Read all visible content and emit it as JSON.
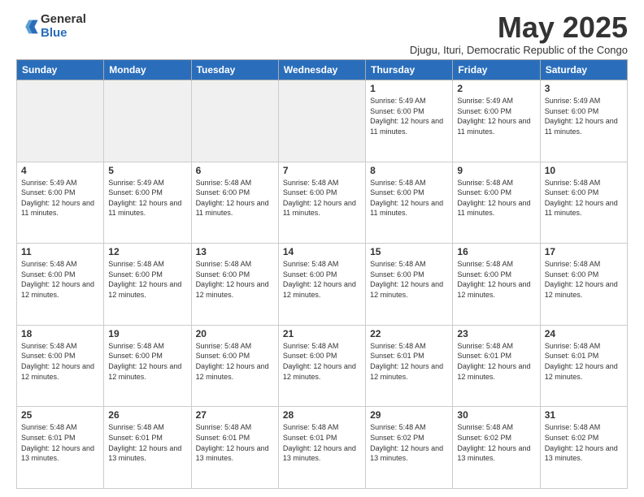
{
  "logo": {
    "general": "General",
    "blue": "Blue"
  },
  "title": "May 2025",
  "subtitle": "Djugu, Ituri, Democratic Republic of the Congo",
  "days_of_week": [
    "Sunday",
    "Monday",
    "Tuesday",
    "Wednesday",
    "Thursday",
    "Friday",
    "Saturday"
  ],
  "weeks": [
    [
      {
        "day": "",
        "info": ""
      },
      {
        "day": "",
        "info": ""
      },
      {
        "day": "",
        "info": ""
      },
      {
        "day": "",
        "info": ""
      },
      {
        "day": "1",
        "info": "Sunrise: 5:49 AM\nSunset: 6:00 PM\nDaylight: 12 hours and 11 minutes."
      },
      {
        "day": "2",
        "info": "Sunrise: 5:49 AM\nSunset: 6:00 PM\nDaylight: 12 hours and 11 minutes."
      },
      {
        "day": "3",
        "info": "Sunrise: 5:49 AM\nSunset: 6:00 PM\nDaylight: 12 hours and 11 minutes."
      }
    ],
    [
      {
        "day": "4",
        "info": "Sunrise: 5:49 AM\nSunset: 6:00 PM\nDaylight: 12 hours and 11 minutes."
      },
      {
        "day": "5",
        "info": "Sunrise: 5:49 AM\nSunset: 6:00 PM\nDaylight: 12 hours and 11 minutes."
      },
      {
        "day": "6",
        "info": "Sunrise: 5:48 AM\nSunset: 6:00 PM\nDaylight: 12 hours and 11 minutes."
      },
      {
        "day": "7",
        "info": "Sunrise: 5:48 AM\nSunset: 6:00 PM\nDaylight: 12 hours and 11 minutes."
      },
      {
        "day": "8",
        "info": "Sunrise: 5:48 AM\nSunset: 6:00 PM\nDaylight: 12 hours and 11 minutes."
      },
      {
        "day": "9",
        "info": "Sunrise: 5:48 AM\nSunset: 6:00 PM\nDaylight: 12 hours and 11 minutes."
      },
      {
        "day": "10",
        "info": "Sunrise: 5:48 AM\nSunset: 6:00 PM\nDaylight: 12 hours and 11 minutes."
      }
    ],
    [
      {
        "day": "11",
        "info": "Sunrise: 5:48 AM\nSunset: 6:00 PM\nDaylight: 12 hours and 12 minutes."
      },
      {
        "day": "12",
        "info": "Sunrise: 5:48 AM\nSunset: 6:00 PM\nDaylight: 12 hours and 12 minutes."
      },
      {
        "day": "13",
        "info": "Sunrise: 5:48 AM\nSunset: 6:00 PM\nDaylight: 12 hours and 12 minutes."
      },
      {
        "day": "14",
        "info": "Sunrise: 5:48 AM\nSunset: 6:00 PM\nDaylight: 12 hours and 12 minutes."
      },
      {
        "day": "15",
        "info": "Sunrise: 5:48 AM\nSunset: 6:00 PM\nDaylight: 12 hours and 12 minutes."
      },
      {
        "day": "16",
        "info": "Sunrise: 5:48 AM\nSunset: 6:00 PM\nDaylight: 12 hours and 12 minutes."
      },
      {
        "day": "17",
        "info": "Sunrise: 5:48 AM\nSunset: 6:00 PM\nDaylight: 12 hours and 12 minutes."
      }
    ],
    [
      {
        "day": "18",
        "info": "Sunrise: 5:48 AM\nSunset: 6:00 PM\nDaylight: 12 hours and 12 minutes."
      },
      {
        "day": "19",
        "info": "Sunrise: 5:48 AM\nSunset: 6:00 PM\nDaylight: 12 hours and 12 minutes."
      },
      {
        "day": "20",
        "info": "Sunrise: 5:48 AM\nSunset: 6:00 PM\nDaylight: 12 hours and 12 minutes."
      },
      {
        "day": "21",
        "info": "Sunrise: 5:48 AM\nSunset: 6:00 PM\nDaylight: 12 hours and 12 minutes."
      },
      {
        "day": "22",
        "info": "Sunrise: 5:48 AM\nSunset: 6:01 PM\nDaylight: 12 hours and 12 minutes."
      },
      {
        "day": "23",
        "info": "Sunrise: 5:48 AM\nSunset: 6:01 PM\nDaylight: 12 hours and 12 minutes."
      },
      {
        "day": "24",
        "info": "Sunrise: 5:48 AM\nSunset: 6:01 PM\nDaylight: 12 hours and 12 minutes."
      }
    ],
    [
      {
        "day": "25",
        "info": "Sunrise: 5:48 AM\nSunset: 6:01 PM\nDaylight: 12 hours and 13 minutes."
      },
      {
        "day": "26",
        "info": "Sunrise: 5:48 AM\nSunset: 6:01 PM\nDaylight: 12 hours and 13 minutes."
      },
      {
        "day": "27",
        "info": "Sunrise: 5:48 AM\nSunset: 6:01 PM\nDaylight: 12 hours and 13 minutes."
      },
      {
        "day": "28",
        "info": "Sunrise: 5:48 AM\nSunset: 6:01 PM\nDaylight: 12 hours and 13 minutes."
      },
      {
        "day": "29",
        "info": "Sunrise: 5:48 AM\nSunset: 6:02 PM\nDaylight: 12 hours and 13 minutes."
      },
      {
        "day": "30",
        "info": "Sunrise: 5:48 AM\nSunset: 6:02 PM\nDaylight: 12 hours and 13 minutes."
      },
      {
        "day": "31",
        "info": "Sunrise: 5:48 AM\nSunset: 6:02 PM\nDaylight: 12 hours and 13 minutes."
      }
    ]
  ]
}
